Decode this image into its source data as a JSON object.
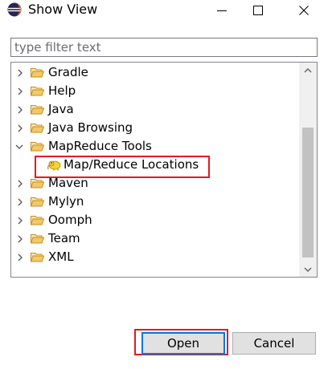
{
  "window": {
    "title": "Show View",
    "icons": {
      "app": "eclipse-icon",
      "minimize": "minimize-icon",
      "maximize": "maximize-icon",
      "close": "close-icon"
    }
  },
  "filter": {
    "value": "",
    "placeholder": "type filter text"
  },
  "tree": {
    "items": [
      {
        "label": "Gradle",
        "expanded": false,
        "icon": "folder-icon"
      },
      {
        "label": "Help",
        "expanded": false,
        "icon": "folder-icon"
      },
      {
        "label": "Java",
        "expanded": false,
        "icon": "folder-icon"
      },
      {
        "label": "Java Browsing",
        "expanded": false,
        "icon": "folder-icon"
      },
      {
        "label": "MapReduce Tools",
        "expanded": true,
        "icon": "folder-icon",
        "children": [
          {
            "label": "Map/Reduce Locations",
            "icon": "elephant-icon",
            "highlighted": true
          }
        ]
      },
      {
        "label": "Maven",
        "expanded": false,
        "icon": "folder-icon"
      },
      {
        "label": "Mylyn",
        "expanded": false,
        "icon": "folder-icon"
      },
      {
        "label": "Oomph",
        "expanded": false,
        "icon": "folder-icon"
      },
      {
        "label": "Team",
        "expanded": false,
        "icon": "folder-icon"
      },
      {
        "label": "XML",
        "expanded": false,
        "icon": "folder-icon"
      }
    ]
  },
  "buttons": {
    "open": "Open",
    "cancel": "Cancel"
  },
  "colors": {
    "highlight_border": "#e01b24",
    "default_button_border": "#0078d7",
    "folder": "#e8b04b"
  }
}
